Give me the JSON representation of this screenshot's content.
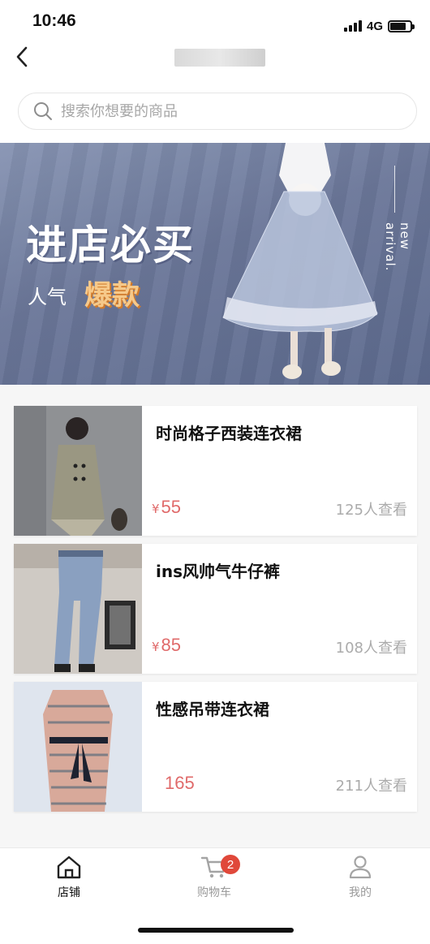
{
  "status_bar": {
    "time": "10:46",
    "network": "4G"
  },
  "nav": {
    "title": ""
  },
  "search": {
    "placeholder": "搜索你想要的商品"
  },
  "banner": {
    "title": "进店必买",
    "subtitle": "人气",
    "highlight": "爆款",
    "side_text": "new arrival."
  },
  "products": [
    {
      "name": "时尚格子西装连衣裙",
      "currency": "¥",
      "price": "55",
      "views": "125人查看"
    },
    {
      "name": "ins风帅气牛仔裤",
      "currency": "¥",
      "price": "85",
      "views": "108人查看"
    },
    {
      "name": "性感吊带连衣裙",
      "currency": "",
      "price": "165",
      "views": "211人查看"
    }
  ],
  "tab_bar": {
    "tabs": [
      {
        "label": "店铺",
        "icon": "store-icon",
        "active": true
      },
      {
        "label": "购物车",
        "icon": "cart-icon",
        "active": false,
        "badge": "2"
      },
      {
        "label": "我的",
        "icon": "profile-icon",
        "active": false
      }
    ]
  },
  "colors": {
    "price": "#e06a6a",
    "badge": "#e0483a",
    "banner_bg": "#6b7799",
    "highlight": "#f6c98a"
  }
}
